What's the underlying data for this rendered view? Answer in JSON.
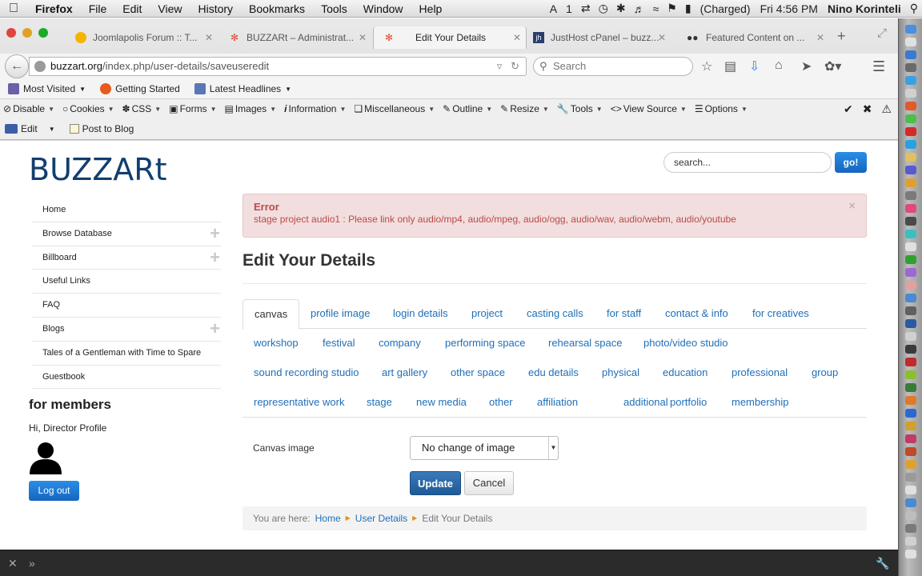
{
  "menubar": {
    "items": [
      "Firefox",
      "File",
      "Edit",
      "View",
      "History",
      "Bookmarks",
      "Tools",
      "Window",
      "Help"
    ],
    "status": {
      "adobe_badge": "1",
      "battery": "(Charged)",
      "time": "Fri 4:56 PM",
      "user": "Nino Korinteli"
    }
  },
  "tabs": [
    {
      "title": "Joomlapolis Forum :: T...",
      "icon": "joomlapolis-icon"
    },
    {
      "title": "BUZZARt – Administrat...",
      "icon": "joomla-icon"
    },
    {
      "title": "Edit Your Details",
      "icon": "joomla-icon",
      "active": true
    },
    {
      "title": "JustHost cPanel – buzz...",
      "icon": "justhost-icon"
    },
    {
      "title": "Featured Content on ...",
      "icon": "people-icon"
    }
  ],
  "urlbar": {
    "domain": "buzzart.org",
    "path": "/index.php/user-details/saveuseredit"
  },
  "searchbar": {
    "placeholder": "Search"
  },
  "bookmarks": [
    "Most Visited",
    "Getting Started",
    "Latest Headlines"
  ],
  "webdev": [
    "Disable",
    "Cookies",
    "CSS",
    "Forms",
    "Images",
    "Information",
    "Miscellaneous",
    "Outline",
    "Resize",
    "Tools",
    "View Source",
    "Options"
  ],
  "blogbar": {
    "edit": "Edit",
    "post": "Post to Blog"
  },
  "site": {
    "logo": "BUZZARt",
    "search_placeholder": "search...",
    "go": "go!"
  },
  "sidemenu": [
    {
      "label": "Home",
      "expandable": false
    },
    {
      "label": "Browse Database",
      "expandable": true
    },
    {
      "label": "Billboard",
      "expandable": true
    },
    {
      "label": "Useful Links",
      "expandable": false
    },
    {
      "label": "FAQ",
      "expandable": false
    },
    {
      "label": "Blogs",
      "expandable": true
    },
    {
      "label": "Tales of a Gentleman with Time to Spare",
      "expandable": false
    },
    {
      "label": "Guestbook",
      "expandable": false
    }
  ],
  "members": {
    "heading": "for members",
    "greeting": "Hi, Director Profile",
    "logout": "Log out"
  },
  "alert": {
    "title": "Error",
    "message": "stage project audio1 : Please link only audio/mp4, audio/mpeg, audio/ogg, audio/wav, audio/webm, audio/youtube",
    "close": "×"
  },
  "main": {
    "title": "Edit Your Details",
    "tabs": [
      "canvas",
      "profile image",
      "login details",
      "project",
      "casting calls",
      "for staff",
      "contact & info",
      "for creatives",
      "workshop",
      "festival",
      "company",
      "performing space",
      "rehearsal space",
      "photo/video studio",
      "sound recording studio",
      "art gallery",
      "other space",
      "edu details",
      "physical",
      "education",
      "professional",
      "group",
      "representative work",
      "stage",
      "new media",
      "other",
      "affiliation",
      "additional",
      "portfolio",
      "membership"
    ],
    "active_tab": "canvas",
    "canvas_label": "Canvas image",
    "canvas_select_value": "No change of image",
    "update": "Update",
    "cancel": "Cancel"
  },
  "breadcrumb": {
    "prefix": "You are here:",
    "items": [
      "Home",
      "User Details",
      "Edit Your Details"
    ]
  },
  "colors": {
    "accent": "#1f6fb8",
    "brand": "#123e6e",
    "error_bg": "#f2dede",
    "error_text": "#b94a48",
    "button_primary": "#1565c0"
  }
}
